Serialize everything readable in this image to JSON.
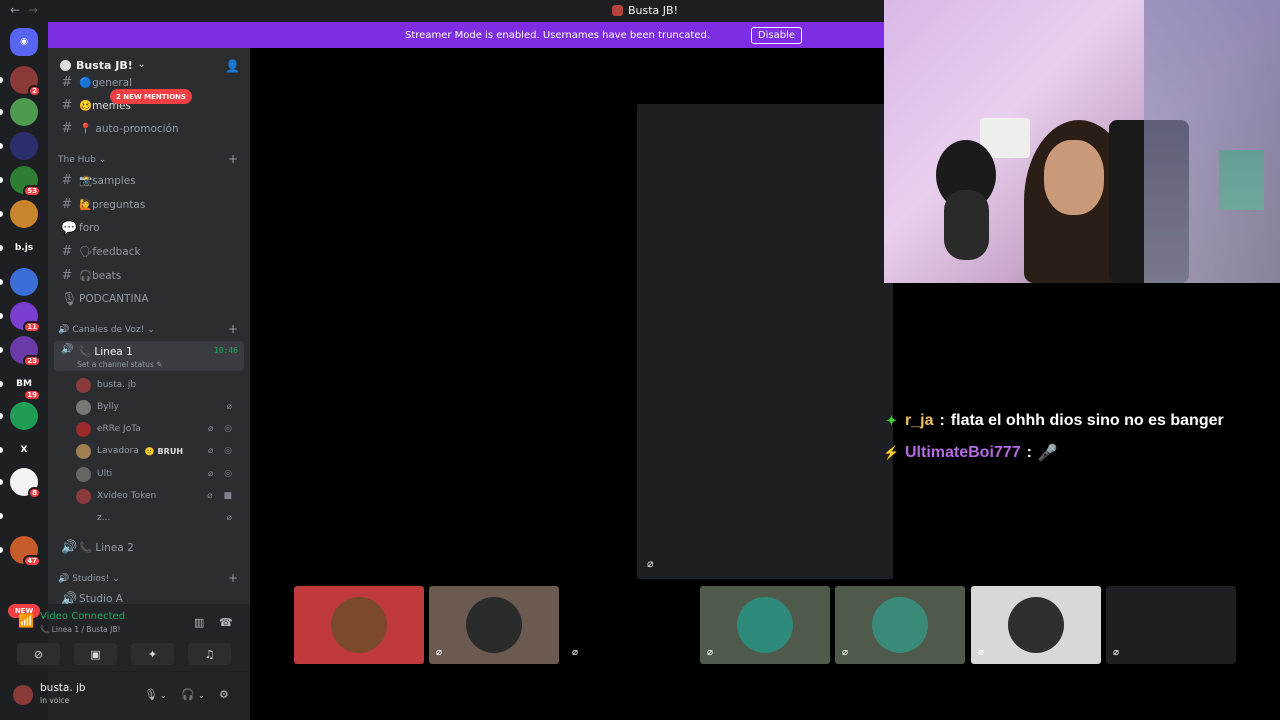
{
  "window": {
    "title": "Busta JB!",
    "back": "←",
    "forward": "→"
  },
  "banner": {
    "text": "Streamer Mode is enabled. Usernames have been truncated.",
    "button": "Disable"
  },
  "rail": {
    "servers": [
      {
        "label": "",
        "badge": "2",
        "color": "#8b3a3a"
      },
      {
        "label": "",
        "badge": "",
        "color": "#4e9a4e"
      },
      {
        "label": "",
        "badge": "",
        "color": "#2a2f6b"
      },
      {
        "label": "",
        "badge": "53",
        "color": "#2e7d32"
      },
      {
        "label": "",
        "badge": "",
        "color": "#c9852b"
      },
      {
        "label": "b.js",
        "badge": "",
        "color": "#1e1f22"
      },
      {
        "label": "",
        "badge": "",
        "color": "#3b6fd6"
      },
      {
        "label": "",
        "badge": "11",
        "color": "#7a3fd1"
      },
      {
        "label": "",
        "badge": "23",
        "color": "#6a3aa8"
      },
      {
        "label": "BM",
        "badge": "19",
        "color": "#1e1f22"
      },
      {
        "label": "",
        "badge": "",
        "color": "#1f9d55"
      },
      {
        "label": "X",
        "badge": "",
        "color": "#1e1f22"
      },
      {
        "label": "",
        "badge": "8",
        "color": "#f2f3f5"
      },
      {
        "label": "",
        "badge": "",
        "color": "#1e1f22"
      },
      {
        "label": "",
        "badge": "47",
        "color": "#c75b2a"
      }
    ],
    "new_label": "NEW"
  },
  "sidebar": {
    "server_name": "Busta JB!",
    "mentions": "2 NEW MENTIONS",
    "channels_top": [
      {
        "name": "general",
        "emoji": "🔵"
      },
      {
        "name": "memes",
        "emoji": "🥴"
      },
      {
        "name": "auto-promoción",
        "emoji": "📍"
      }
    ],
    "hub_category": "The Hub",
    "hub_channels": [
      {
        "name": "samples",
        "emoji": "📸",
        "icon": "#"
      },
      {
        "name": "preguntas",
        "emoji": "🙋",
        "icon": "#"
      },
      {
        "name": "foro",
        "emoji": "",
        "icon": "💬"
      },
      {
        "name": "feedback",
        "emoji": "🗣",
        "icon": "#"
      },
      {
        "name": "beats",
        "emoji": "🎧",
        "icon": "#"
      },
      {
        "name": "PODCANTINA",
        "emoji": "",
        "icon": "🎙"
      }
    ],
    "voice_category": "Canales de Voz!",
    "linea1": {
      "name": "📞 Linea 1",
      "time": "10:46",
      "status": "Set a channel status ✎"
    },
    "voice_users": [
      {
        "name": "busta. jb",
        "tag": "",
        "icons": "",
        "color": "#8b3a3a"
      },
      {
        "name": "Bylly",
        "tag": "",
        "icons": "⌀",
        "color": "#777"
      },
      {
        "name": "eRRe JoTa",
        "tag": "",
        "icons": "⌀ ◎",
        "color": "#9b2a2a"
      },
      {
        "name": "Lavadora",
        "tag": "🙂 BRUH",
        "icons": "⌀ ◎",
        "color": "#a08050"
      },
      {
        "name": "Ulti",
        "tag": "",
        "icons": "⌀ ◎",
        "color": "#666"
      },
      {
        "name": "Xvideo Token",
        "tag": "",
        "icons": "⌀ ■",
        "color": "#8b3a3a"
      },
      {
        "name": "z...",
        "tag": "",
        "icons": "⌀",
        "color": "#2b2d31"
      }
    ],
    "linea2": "📞 Linea 2",
    "studios_category": "Studios!",
    "studio_a": "Studio A"
  },
  "voice_panel": {
    "status": "Video Connected",
    "sub": "📞 Linea 1 / Busta JB!"
  },
  "user_panel": {
    "name": "busta. jb",
    "status": "In voice"
  },
  "tiles": [
    {
      "bg": "#c0393b",
      "avatar": "#7a4a2a",
      "muted": false
    },
    {
      "bg": "#6b5a50",
      "avatar": "#2b2b2b",
      "muted": true
    },
    {
      "bg": "#000000",
      "avatar": "#000000",
      "muted": true
    },
    {
      "bg": "#4f5a4a",
      "avatar": "#2e8a7a",
      "muted": true
    },
    {
      "bg": "#4f5a4a",
      "avatar": "#3a8a7a",
      "muted": true
    },
    {
      "bg": "#d8d8d8",
      "avatar": "#2f2f2f",
      "muted": true
    },
    {
      "bg": "#1e1f22",
      "avatar": "#1e1f22",
      "muted": true
    }
  ],
  "chat": [
    {
      "icon": "✦",
      "icon_color": "#3fd13f",
      "user": "r_ja",
      "user_color": "#f0c060",
      "text": "flata el ohhh dios sino no es banger"
    },
    {
      "icon": "⚡",
      "icon_color": "#3fa9f5",
      "user": "UltimateBoi777",
      "user_color": "#b36be0",
      "text": "🎤"
    }
  ]
}
